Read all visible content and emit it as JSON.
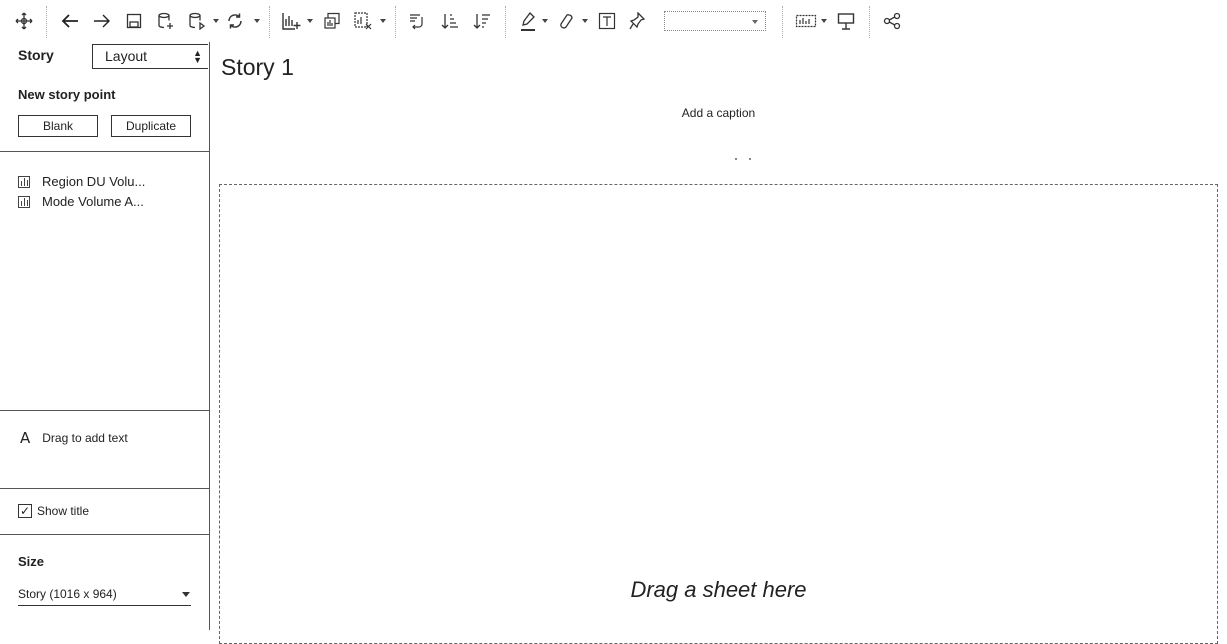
{
  "toolbar": {
    "icons": [
      "move-icon",
      "undo-icon",
      "redo-icon",
      "save-icon",
      "new-data-source-icon",
      "pause-updates-icon",
      "refresh-icon",
      "new-worksheet-icon",
      "duplicate-sheet-icon",
      "clear-sheet-icon",
      "swap-rows-columns-icon",
      "sort-ascending-icon",
      "sort-descending-icon",
      "highlight-icon",
      "group-icon",
      "show-labels-icon",
      "pin-icon",
      "fit-dropdown",
      "show-me-icon",
      "presentation-icon",
      "share-icon"
    ],
    "fit_value": ""
  },
  "sidebar": {
    "tab_story": "Story",
    "tab_layout": "Layout",
    "new_story_point": "New story point",
    "blank_button": "Blank",
    "duplicate_button": "Duplicate",
    "sheets": [
      {
        "label": "Region DU Volu..."
      },
      {
        "label": "Mode Volume A..."
      }
    ],
    "drag_text_icon": "A",
    "drag_text": "Drag to add text",
    "show_title_checked": true,
    "show_title": "Show title",
    "size_heading": "Size",
    "size_value": "Story (1016 x 964)"
  },
  "story": {
    "title": "Story 1",
    "caption": "Add a caption",
    "drop_hint": "Drag a sheet here"
  },
  "colors": {
    "border": "#555555",
    "text": "#222222",
    "background": "#ffffff"
  }
}
